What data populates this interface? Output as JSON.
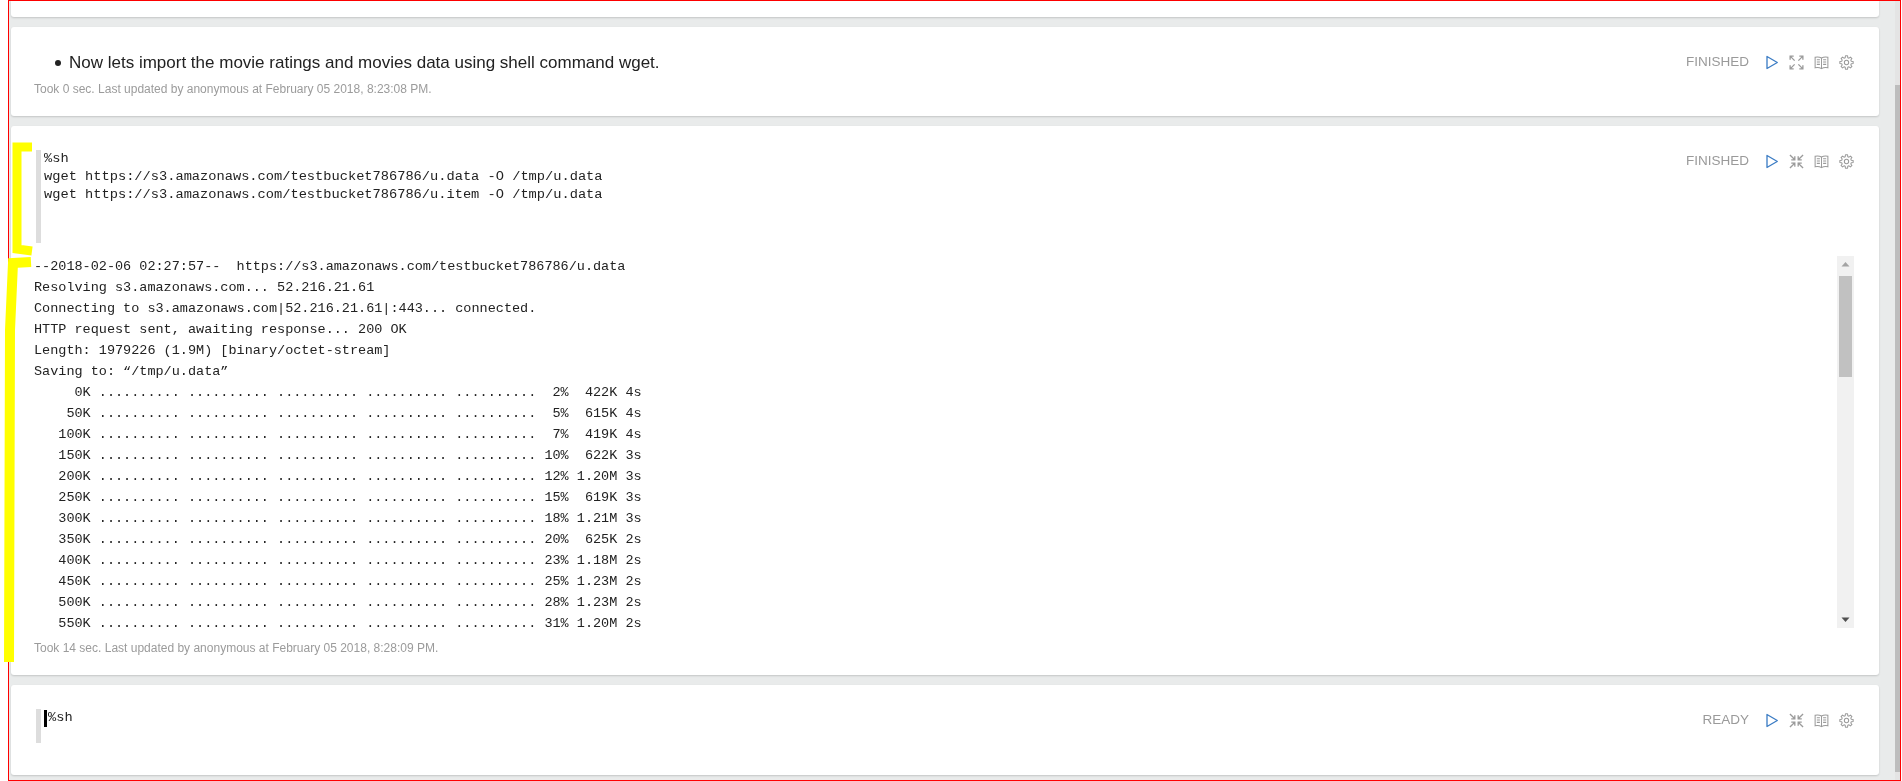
{
  "notebook": {
    "paragraphs": [
      {
        "kind": "markdown",
        "editor_shown": false,
        "bullets": [
          "Now lets import the movie ratings and movies data using shell command wget."
        ],
        "status": "FINISHED",
        "footer": "Took 0 sec. Last updated by anonymous at February 05 2018, 8:23:08 PM."
      },
      {
        "kind": "code",
        "editor_shown": true,
        "focused": false,
        "code": [
          "%sh",
          "wget https://s3.amazonaws.com/testbucket786786/u.data -O /tmp/u.data",
          "wget https://s3.amazonaws.com/testbucket786786/u.item -O /tmp/u.data"
        ],
        "status": "FINISHED",
        "output": [
          "--2018-02-06 02:27:57--  https://s3.amazonaws.com/testbucket786786/u.data",
          "Resolving s3.amazonaws.com... 52.216.21.61",
          "Connecting to s3.amazonaws.com|52.216.21.61|:443... connected.",
          "HTTP request sent, awaiting response... 200 OK",
          "Length: 1979226 (1.9M) [binary/octet-stream]",
          "Saving to: “/tmp/u.data”",
          "     0K .......... .......... .......... .......... ..........  2%  422K 4s",
          "    50K .......... .......... .......... .......... ..........  5%  615K 4s",
          "   100K .......... .......... .......... .......... ..........  7%  419K 4s",
          "   150K .......... .......... .......... .......... .......... 10%  622K 3s",
          "   200K .......... .......... .......... .......... .......... 12% 1.20M 3s",
          "   250K .......... .......... .......... .......... .......... 15%  619K 3s",
          "   300K .......... .......... .......... .......... .......... 18% 1.21M 3s",
          "   350K .......... .......... .......... .......... .......... 20%  625K 2s",
          "   400K .......... .......... .......... .......... .......... 23% 1.18M 2s",
          "   450K .......... .......... .......... .......... .......... 25% 1.23M 2s",
          "   500K .......... .......... .......... .......... .......... 28% 1.23M 2s",
          "   550K .......... .......... .......... .......... .......... 31% 1.20M 2s"
        ],
        "footer": "Took 14 sec. Last updated by anonymous at February 05 2018, 8:28:09 PM."
      },
      {
        "kind": "code",
        "editor_shown": true,
        "focused": true,
        "code": [
          "%sh"
        ],
        "status": "READY"
      }
    ]
  }
}
